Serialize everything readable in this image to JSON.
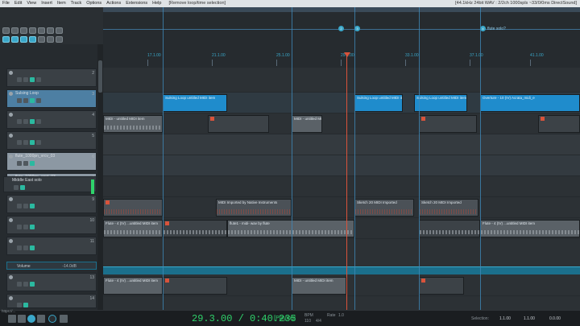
{
  "menubar": {
    "items": [
      "File",
      "Edit",
      "View",
      "Insert",
      "Item",
      "Track",
      "Options",
      "Actions",
      "Extensions",
      "Help"
    ],
    "action": "[Remove loop/time selection]",
    "audio_status": "[44.1kHz 24bit WAV : 2/2ch 1000spls ~33/0/0ms DirectSound]"
  },
  "ruler": {
    "ticks": [
      "17.1.00",
      "21.1.00",
      "25.1.00",
      "29.1.00",
      "33.1.00",
      "37.1.00",
      "41.1.00",
      "45.1.00",
      "49.1.00"
    ],
    "markers": [
      {
        "num": "2",
        "label": ""
      },
      {
        "num": "3",
        "label": ""
      },
      {
        "num": "4",
        "label": "flute solo?"
      }
    ]
  },
  "tracks": [
    {
      "name": "",
      "num": "2"
    },
    {
      "name": "Sulsing Loop",
      "num": "3"
    },
    {
      "name": "",
      "num": "4"
    },
    {
      "name": "",
      "num": "5"
    },
    {
      "name": "flute_1000pn_vrcv_03",
      "num": "6"
    },
    {
      "name": "flute_1000pn_ennt_03",
      "num": "7"
    },
    {
      "name": "Middle East solo",
      "num": ""
    },
    {
      "name": "",
      "num": "9"
    },
    {
      "name": "",
      "num": "10"
    },
    {
      "name": "",
      "num": "11"
    },
    {
      "name": "",
      "num": "12"
    },
    {
      "name": "",
      "num": "13"
    },
    {
      "name": "",
      "num": "14"
    }
  ],
  "volume_lane": {
    "name": "Volume",
    "value": "-14.0dB"
  },
  "items": {
    "sulsing": "Sulsing Loop untitled MIDI item",
    "sulsing2": "Sulsing Loop untitled MIDI item",
    "sulsing3": "Sulsing Loop untitled MIDI item",
    "overture": "Overture, Ho...",
    "overture2": "Overture - 10 (IV) Acrata_midi_e",
    "midi1": "MIDI - untitled MIDI item",
    "midi2": "MIDI Imported by Native Instruments",
    "midi3": "Sketch 20 MIDI Imported",
    "midi4": "Sketch 20 MIDI Imported",
    "flute": "Flute - 4 (IV) ...untitled MIDI item",
    "flute2": "flute1 - midi- wav by flute"
  },
  "transport": {
    "time": "29.3.00 / 0:40.235",
    "status": "[Playing]",
    "bpm_label": "BPM",
    "bpm": "110",
    "sig": "4/4",
    "rate_label": "Rate",
    "rate": "1.0",
    "selection_label": "Selection:",
    "sel_start": "1.1.00",
    "sel_end": "1.1.00",
    "sel_len": "0.0.00"
  },
  "status_line": "https://..."
}
